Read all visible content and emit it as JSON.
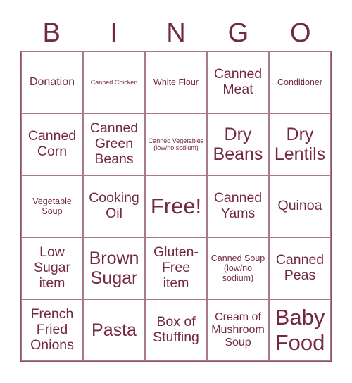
{
  "header": {
    "letters": [
      "B",
      "I",
      "N",
      "G",
      "O"
    ]
  },
  "colors": {
    "accent": "#722a3c",
    "grid_line": "#a97a87"
  },
  "cells": [
    {
      "text": "Donation",
      "size": "md"
    },
    {
      "text": "Canned Chicken",
      "size": "xs"
    },
    {
      "text": "White Flour",
      "size": "sm"
    },
    {
      "text": "Canned Meat",
      "size": "lg"
    },
    {
      "text": "Conditioner",
      "size": "sm"
    },
    {
      "text": "Canned Corn",
      "size": "lg"
    },
    {
      "text": "Canned Green Beans",
      "size": "lg"
    },
    {
      "text": "Canned Vegetables (low/no sodium)",
      "size": "xs"
    },
    {
      "text": "Dry Beans",
      "size": "xl"
    },
    {
      "text": "Dry Lentils",
      "size": "xl"
    },
    {
      "text": "Vegetable Soup",
      "size": "sm"
    },
    {
      "text": "Cooking Oil",
      "size": "lg"
    },
    {
      "text": "Free!",
      "size": "xxl"
    },
    {
      "text": "Canned Yams",
      "size": "lg"
    },
    {
      "text": "Quinoa",
      "size": "lg"
    },
    {
      "text": "Low Sugar item",
      "size": "lg"
    },
    {
      "text": "Brown Sugar",
      "size": "xl"
    },
    {
      "text": "Gluten-Free item",
      "size": "lg"
    },
    {
      "text": "Canned Soup (low/no sodium)",
      "size": "sm"
    },
    {
      "text": "Canned Peas",
      "size": "lg"
    },
    {
      "text": "French Fried Onions",
      "size": "lg"
    },
    {
      "text": "Pasta",
      "size": "xl"
    },
    {
      "text": "Box of Stuffing",
      "size": "lg"
    },
    {
      "text": "Cream of Mushroom Soup",
      "size": "md"
    },
    {
      "text": "Baby Food",
      "size": "xxl"
    }
  ]
}
